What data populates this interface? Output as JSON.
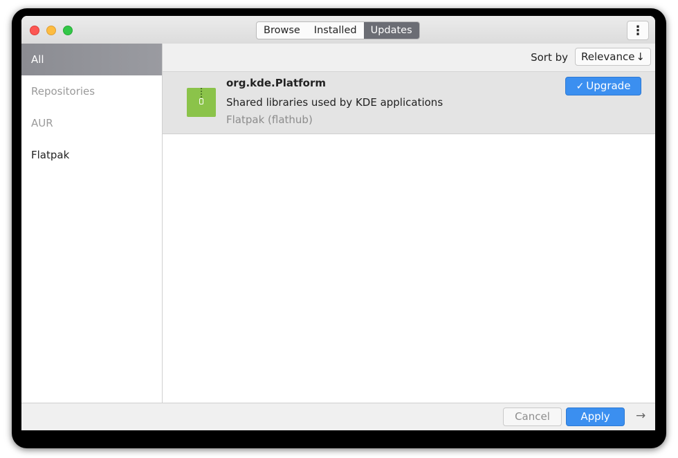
{
  "tabs": [
    {
      "label": "Browse"
    },
    {
      "label": "Installed"
    },
    {
      "label": "Updates"
    }
  ],
  "active_tab": "Updates",
  "sidebar": {
    "items": [
      {
        "label": "All"
      },
      {
        "label": "Repositories"
      },
      {
        "label": "AUR"
      },
      {
        "label": "Flatpak"
      }
    ]
  },
  "sort": {
    "label": "Sort by",
    "value": "Relevance"
  },
  "package": {
    "name": "org.kde.Platform",
    "description": "Shared libraries used by KDE applications",
    "source": "Flatpak (flathub)",
    "action": "Upgrade"
  },
  "footer": {
    "cancel": "Cancel",
    "apply": "Apply"
  },
  "colors": {
    "accent": "#3b8ff0",
    "selected_sidebar": "#8b8c92",
    "package_icon": "#8bc34a"
  }
}
